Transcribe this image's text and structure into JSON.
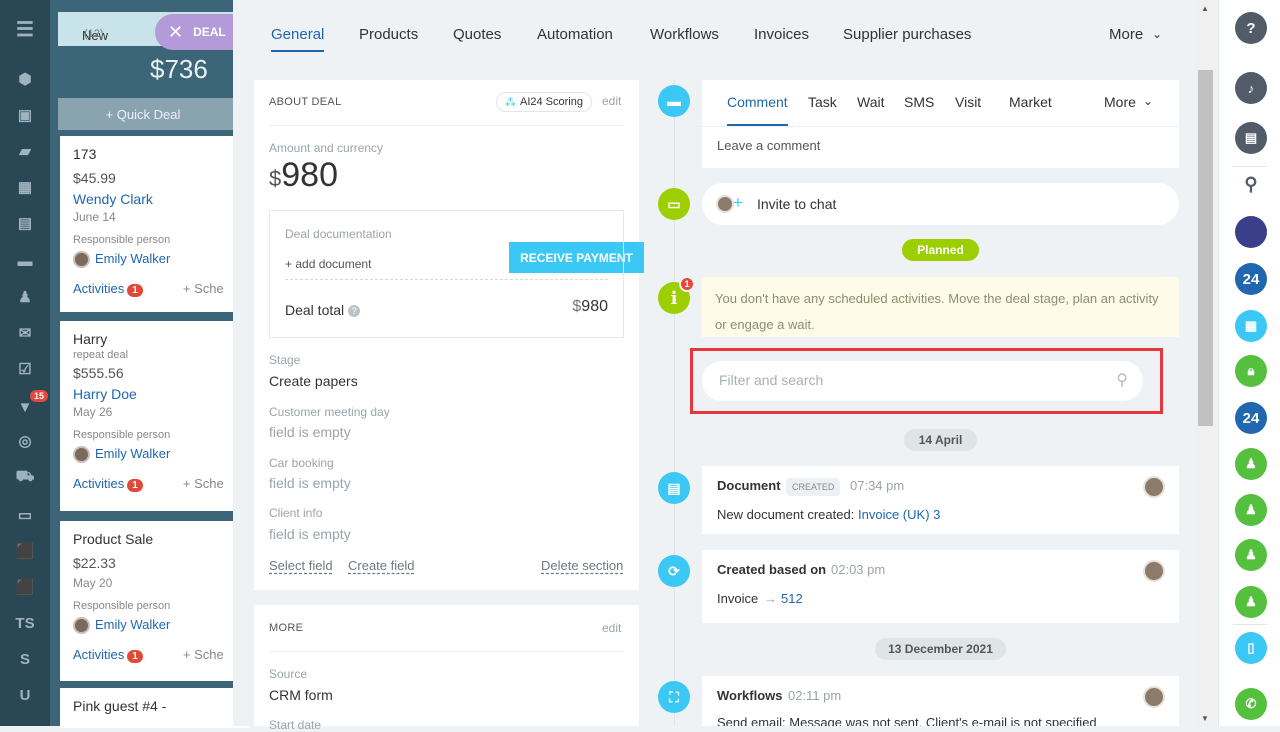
{
  "leftbar": {
    "ts_label": "TS",
    "s_label": "S",
    "u_label": "U",
    "badge": "15"
  },
  "kanban": {
    "column_title": "New",
    "column_count": "(12)",
    "deal_tab": "DEAL",
    "total": "$736",
    "quick_deal": "+ Quick Deal",
    "cards": [
      {
        "title": "173",
        "price": "$45.99",
        "client": "Wendy Clark",
        "date": "June 14",
        "resp_label": "Responsible person",
        "resp": "Emily Walker",
        "activities": "Activities",
        "badge": "1",
        "sched": "+ Sche"
      },
      {
        "title": "Harry",
        "sub": "repeat deal",
        "price": "$555.56",
        "client": "Harry Doe",
        "date": "May 26",
        "resp_label": "Responsible person",
        "resp": "Emily Walker",
        "activities": "Activities",
        "badge": "1",
        "sched": "+ Sche"
      },
      {
        "title": "Product Sale",
        "price": "$22.33",
        "date": "May 20",
        "resp_label": "Responsible person",
        "resp": "Emily Walker",
        "activities": "Activities",
        "badge": "1",
        "sched": "+ Sche"
      },
      {
        "title": "Pink guest #4 -"
      }
    ]
  },
  "tabs": [
    "General",
    "Products",
    "Quotes",
    "Automation",
    "Workflows",
    "Invoices",
    "Supplier purchases",
    "More"
  ],
  "about": {
    "title": "ABOUT DEAL",
    "scoring": "AI24 Scoring",
    "edit": "edit",
    "amount_label": "Amount and currency",
    "currency": "$",
    "amount": "980",
    "pay_button": "RECEIVE PAYMENT",
    "doc_label": "Deal documentation",
    "add_doc": "+ add document",
    "total_label": "Deal total",
    "total_currency": "$",
    "total_value": "980",
    "stage_label": "Stage",
    "stage": "Create papers",
    "meeting_label": "Customer meeting day",
    "meeting": "field is empty",
    "car_label": "Car booking",
    "car": "field is empty",
    "client_label": "Client info",
    "client": "field is empty",
    "select_field": "Select field",
    "create_field": "Create field",
    "delete_section": "Delete section"
  },
  "more": {
    "title": "MORE",
    "edit": "edit",
    "source_label": "Source",
    "source": "CRM form",
    "start_label": "Start date"
  },
  "timeline": {
    "tabs": [
      "Comment",
      "Task",
      "Wait",
      "SMS",
      "Visit",
      "Market",
      "More"
    ],
    "comment_placeholder": "Leave a comment",
    "invite": "Invite to chat",
    "planned": "Planned",
    "notice_badge": "1",
    "notice": "You don't have any scheduled activities. Move the deal stage, plan an activity or engage a wait.",
    "search_placeholder": "Filter and search",
    "date1": "14 April",
    "doc_title": "Document",
    "doc_tag": "CREATED",
    "doc_time": "07:34 pm",
    "doc_text": "New document created:",
    "doc_link": "Invoice (UK) 3",
    "based_title": "Created based on",
    "based_time": "02:03 pm",
    "based_text": "Invoice",
    "based_arrow": "→",
    "based_link": "512",
    "date2": "13 December 2021",
    "wf_title": "Workflows",
    "wf_time": "02:11 pm",
    "wf_text": "Send email: Message was not sent. Client's e-mail is not specified"
  },
  "rightbar": {
    "help": "?",
    "b24": "24"
  }
}
